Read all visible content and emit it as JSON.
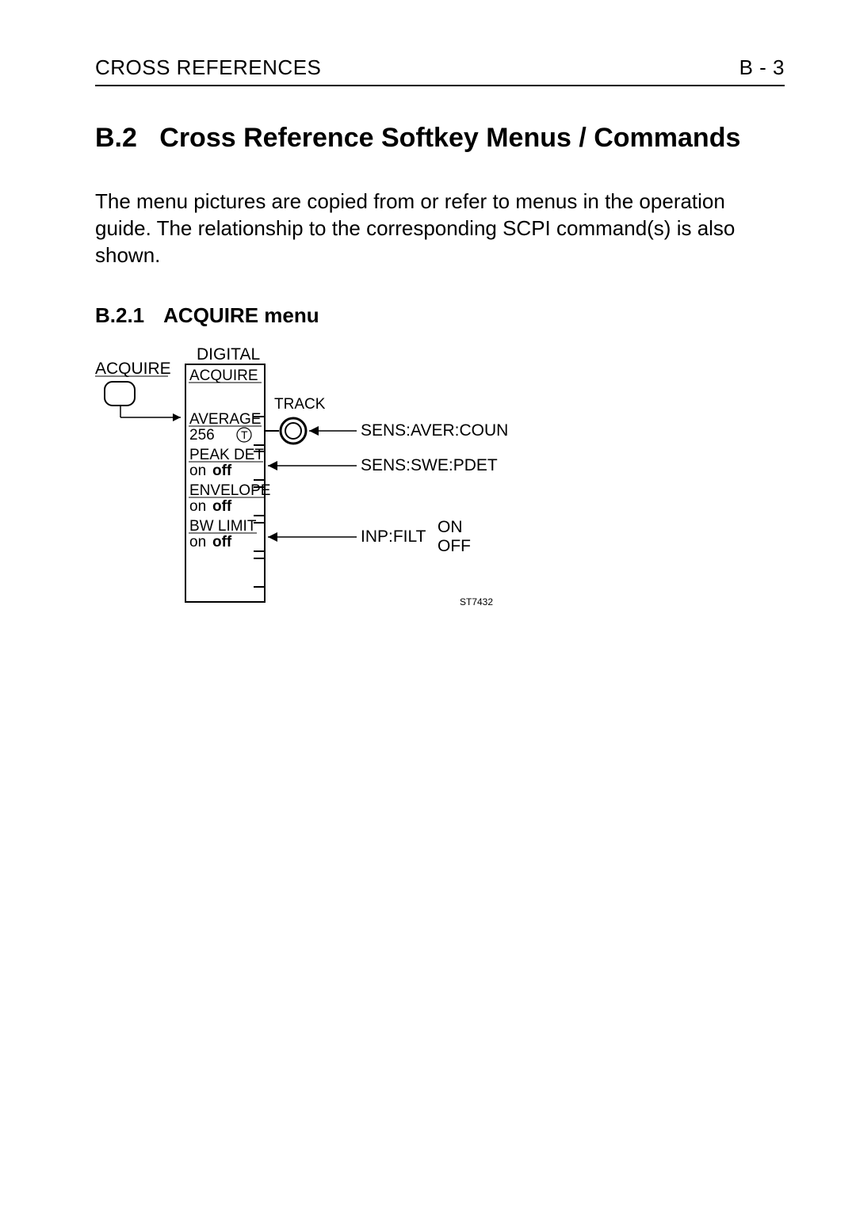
{
  "header": {
    "left": "CROSS REFERENCES",
    "right": "B - 3"
  },
  "section": {
    "number": "B.2",
    "title": "Cross Reference Softkey Menus / Commands"
  },
  "intro_text": "The menu pictures are copied from or refer to menus in the operation guide. The relationship to the corresponding SCPI command(s) is also shown.",
  "subsection": {
    "number": "B.2.1",
    "title": "ACQUIRE menu"
  },
  "diagram": {
    "button_label": "ACQUIRE",
    "menu_heading": "DIGITAL",
    "menu_title": "ACQUIRE",
    "track_label": "TRACK",
    "softkeys": [
      {
        "label1": "AVERAGE",
        "label2_left": "256",
        "label2_right_icon": "T"
      },
      {
        "label1": "PEAK DET",
        "label2_left": "on",
        "label2_right": "off"
      },
      {
        "label1": "ENVELOPE",
        "label2_left": "on",
        "label2_right": "off"
      },
      {
        "label1": "BW LIMIT",
        "label2_left": "on",
        "label2_right": "off"
      }
    ],
    "commands": {
      "avg": "SENS:AVER:COUN",
      "pdet": "SENS:SWE:PDET",
      "filt": "INP:FILT",
      "filt_on": "ON",
      "filt_off": "OFF"
    },
    "diagram_id": "ST7432"
  }
}
